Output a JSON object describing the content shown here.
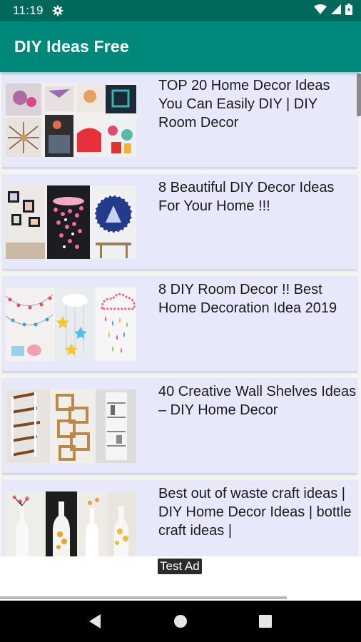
{
  "status_bar": {
    "time": "11:19"
  },
  "app_bar": {
    "title": "DIY Ideas Free"
  },
  "items": [
    {
      "title": "TOP 20 Home Decor Ideas You Can Easily DIY | DIY Room Decor"
    },
    {
      "title": "8 Beautiful DIY Decor Ideas For Your Home !!!"
    },
    {
      "title": "8 DIY Room Decor !! Best Home Decoration Idea 2019"
    },
    {
      "title": "40 Creative Wall Shelves Ideas – DIY Home Decor"
    },
    {
      "title": "Best out of waste craft ideas | DIY Home Decor Ideas | bottle craft ideas |"
    }
  ],
  "ad": {
    "label": "Test Ad"
  }
}
